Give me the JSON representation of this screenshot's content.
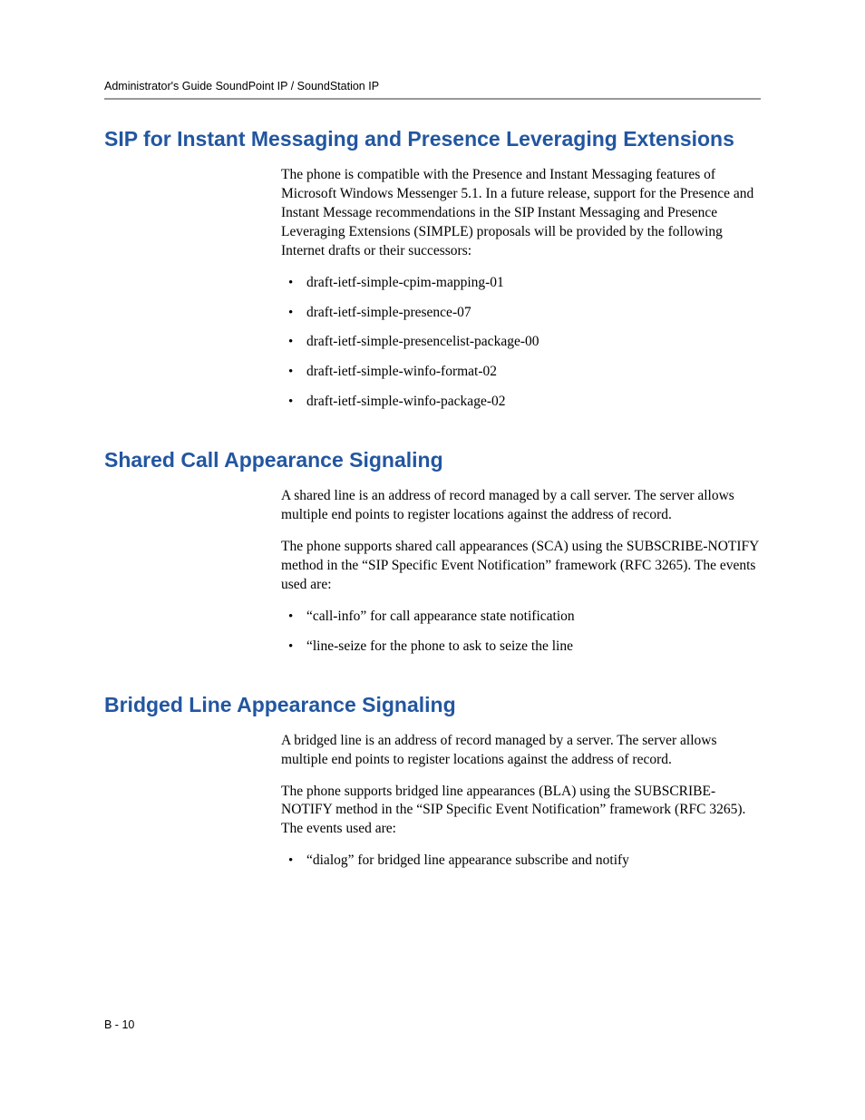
{
  "header": {
    "running_head": "Administrator's Guide SoundPoint IP / SoundStation IP"
  },
  "sections": [
    {
      "heading": "SIP for Instant Messaging and Presence Leveraging Extensions",
      "paragraphs": [
        "The phone is compatible with the Presence and Instant Messaging features of Microsoft Windows Messenger 5.1. In a future release, support for the Presence and Instant Message recommendations in the SIP Instant Messaging and Presence Leveraging Extensions (SIMPLE) proposals will be provided by the following Internet drafts or their successors:"
      ],
      "bullets": [
        "draft-ietf-simple-cpim-mapping-01",
        "draft-ietf-simple-presence-07",
        "draft-ietf-simple-presencelist-package-00",
        "draft-ietf-simple-winfo-format-02",
        "draft-ietf-simple-winfo-package-02"
      ]
    },
    {
      "heading": "Shared Call Appearance Signaling",
      "paragraphs": [
        "A shared line is an address of record managed by a call server. The server allows multiple end points to register locations against the address of record.",
        "The phone supports shared call appearances (SCA) using the SUBSCRIBE-NOTIFY method in the “SIP Specific Event Notification” framework (RFC 3265). The events used are:"
      ],
      "bullets": [
        "“call-info” for call appearance state notification",
        "“line-seize for the phone to ask to seize the line"
      ]
    },
    {
      "heading": "Bridged Line Appearance Signaling",
      "paragraphs": [
        "A bridged line is an address of record managed by a server. The server allows multiple end points to register locations against the address of record.",
        "The phone supports bridged line appearances (BLA) using the SUBSCRIBE-NOTIFY method in the “SIP Specific Event Notification” framework (RFC 3265). The events used are:"
      ],
      "bullets": [
        "“dialog” for bridged line appearance subscribe and notify"
      ]
    }
  ],
  "footer": {
    "page_number": "B - 10"
  }
}
